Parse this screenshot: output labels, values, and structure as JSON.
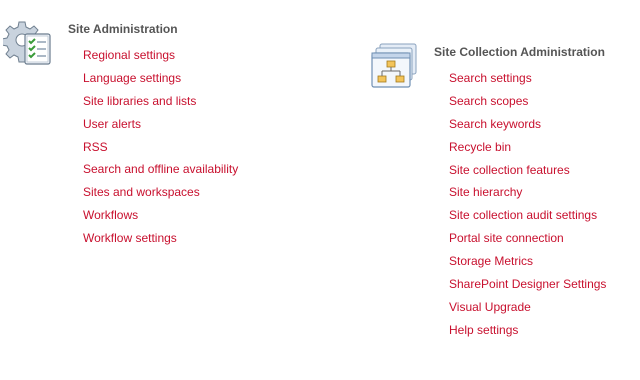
{
  "site_administration": {
    "title": "Site Administration",
    "icon": "settings-gear-checklist-icon",
    "links": [
      "Regional settings",
      "Language settings",
      "Site libraries and lists",
      "User alerts",
      "RSS",
      "Search and offline availability",
      "Sites and workspaces",
      "Workflows",
      "Workflow settings"
    ]
  },
  "site_collection_administration": {
    "title": "Site Collection Administration",
    "icon": "site-hierarchy-windows-icon",
    "links": [
      "Search settings",
      "Search scopes",
      "Search keywords",
      "Recycle bin",
      "Site collection features",
      "Site hierarchy",
      "Site collection audit settings",
      "Portal site connection",
      "Storage Metrics",
      "SharePoint Designer Settings",
      "Visual Upgrade",
      "Help settings"
    ]
  },
  "colors": {
    "link": "#c8102e",
    "heading": "#555555"
  }
}
